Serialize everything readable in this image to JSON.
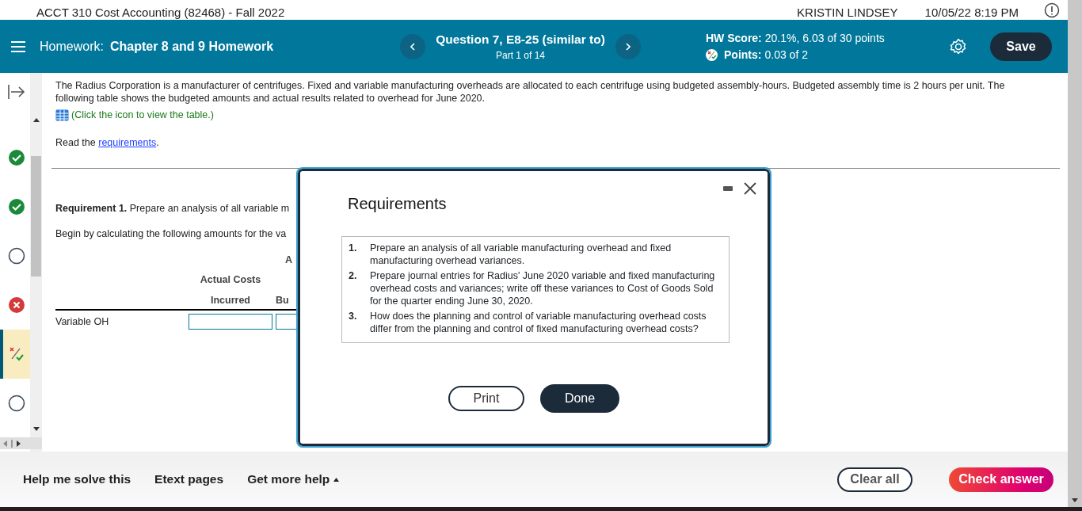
{
  "course_bar": {
    "course": "ACCT 310 Cost Accounting (82468) - Fall 2022",
    "user": "KRISTIN LINDSEY",
    "datetime": "10/05/22 8:19 PM"
  },
  "header": {
    "label": "Homework:",
    "title": "Chapter 8 and 9 Homework",
    "question": "Question 7, E8-25 (similar to)",
    "part": "Part 1 of 14",
    "hw_score_label": "HW Score:",
    "hw_score": "20.1%, 6.03 of 30 points",
    "points_label": "Points:",
    "points": "0.03 of 2",
    "save": "Save"
  },
  "question_nav": [
    {
      "kind": "correct",
      "selected": false
    },
    {
      "kind": "correct",
      "selected": false
    },
    {
      "kind": "unanswered",
      "selected": false
    },
    {
      "kind": "incorrect",
      "selected": false
    },
    {
      "kind": "partial",
      "selected": true
    },
    {
      "kind": "unanswered",
      "selected": false
    }
  ],
  "problem": {
    "intro": "The Radius Corporation is a manufacturer of centrifuges. Fixed and variable manufacturing overheads are allocated to each centrifuge using budgeted assembly-hours. Budgeted assembly time is 2 hours per unit. The following table shows the budgeted amounts and actual results related to overhead for June 2020.",
    "table_link": "(Click the icon to view the table.)",
    "read_prefix": "Read the ",
    "read_link": "requirements",
    "read_suffix": "."
  },
  "requirement": "**Requirement 1.** Prepare an analysis of all variable m",
  "instruction": "Begin by calculating the following amounts for the va",
  "table": {
    "group_header": "A",
    "columns": [
      {
        "line1": "Actual Costs",
        "line2": "Incurred"
      },
      {
        "line2": "Bu"
      }
    ],
    "rows": [
      {
        "label": "Variable OH"
      }
    ]
  },
  "modal": {
    "title": "Requirements",
    "items": [
      {
        "number": "1.",
        "text": "Prepare an analysis of all variable manufacturing overhead and fixed manufacturing overhead variances."
      },
      {
        "number": "2.",
        "text": "Prepare journal entries for Radius' June 2020 variable and fixed manufacturing overhead costs and variances; write off these variances to Cost of Goods Sold for the quarter ending June 30, 2020."
      },
      {
        "number": "3.",
        "text": "How does the planning and control of variable manufacturing overhead costs differ from the planning and control of fixed manufacturing overhead costs?"
      }
    ],
    "buttons": [
      {
        "label": "Print",
        "kind": "outline"
      },
      {
        "label": "Done",
        "kind": "primary"
      }
    ]
  },
  "footer": {
    "links": [
      {
        "label": "Help me solve this",
        "dropdown": false
      },
      {
        "label": "Etext pages",
        "dropdown": false
      },
      {
        "label": "Get more help",
        "dropdown": true
      }
    ],
    "clear": "Clear all",
    "check": "Check answer"
  }
}
